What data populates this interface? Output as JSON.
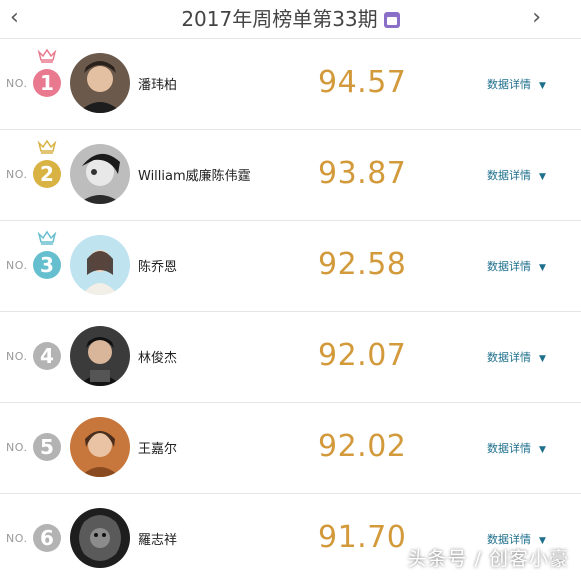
{
  "header": {
    "title": "2017年周榜单第33期",
    "prev_icon": "chevron-left-icon",
    "next_icon": "chevron-right-icon",
    "calendar_icon": "calendar-icon",
    "prev_symbol": "‹",
    "next_symbol": "›"
  },
  "entries": [
    {
      "no_label": "NO.",
      "rank": "1",
      "name": "潘玮柏",
      "score": "94.57",
      "detail_label": "数据详情",
      "rank_color": "#e8798e",
      "crown_color": "#e8798e"
    },
    {
      "no_label": "NO.",
      "rank": "2",
      "name": "William威廉陈伟霆",
      "score": "93.87",
      "detail_label": "数据详情",
      "rank_color": "#d9b244",
      "crown_color": "#d9b244"
    },
    {
      "no_label": "NO.",
      "rank": "3",
      "name": "陈乔恩",
      "score": "92.58",
      "detail_label": "数据详情",
      "rank_color": "#66bfcf",
      "crown_color": "#66bfcf"
    },
    {
      "no_label": "NO.",
      "rank": "4",
      "name": "林俊杰",
      "score": "92.07",
      "detail_label": "数据详情",
      "rank_color": "#b3b3b3"
    },
    {
      "no_label": "NO.",
      "rank": "5",
      "name": "王嘉尔",
      "score": "92.02",
      "detail_label": "数据详情",
      "rank_color": "#b3b3b3"
    },
    {
      "no_label": "NO.",
      "rank": "6",
      "name": "羅志祥",
      "score": "91.70",
      "detail_label": "数据详情",
      "rank_color": "#b3b3b3"
    }
  ],
  "watermark": "头条号 / 创客小豪"
}
